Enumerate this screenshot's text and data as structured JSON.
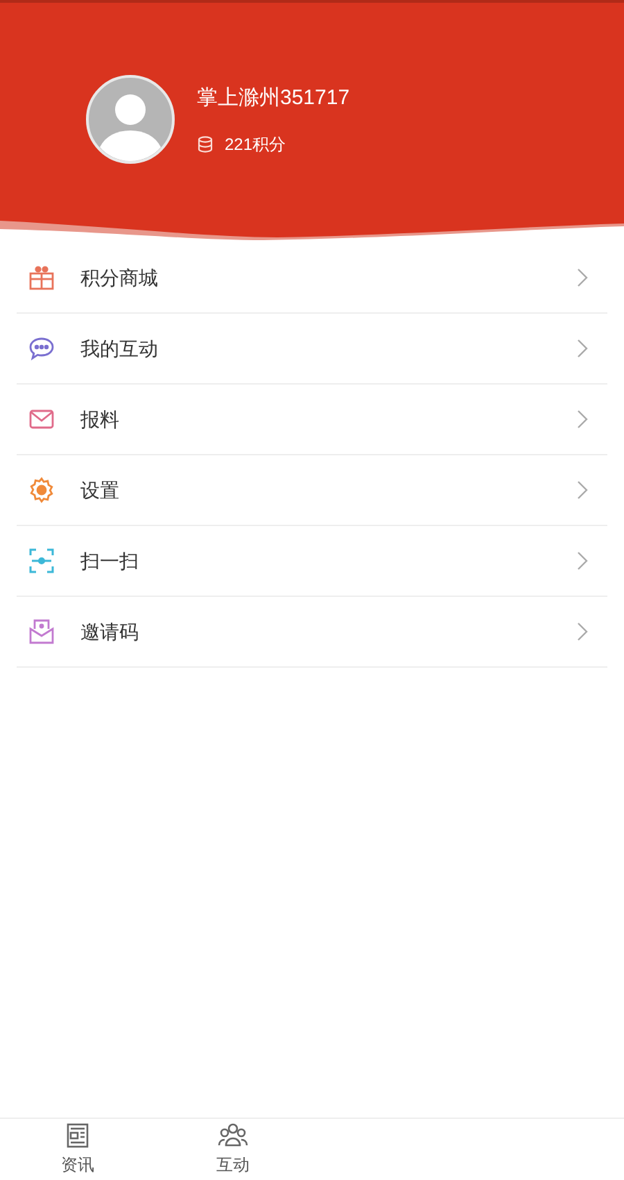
{
  "profile": {
    "name": "掌上滁州351717",
    "points": "221积分"
  },
  "menu": [
    {
      "kind": "gift",
      "label": "积分商城"
    },
    {
      "kind": "chat",
      "label": "我的互动"
    },
    {
      "kind": "mail",
      "label": "报料"
    },
    {
      "kind": "gear",
      "label": "设置"
    },
    {
      "kind": "scan",
      "label": "扫一扫"
    },
    {
      "kind": "invite",
      "label": "邀请码"
    }
  ],
  "tab_bar": [
    {
      "kind": "news",
      "label": "资讯"
    },
    {
      "kind": "group",
      "label": "互动"
    }
  ]
}
